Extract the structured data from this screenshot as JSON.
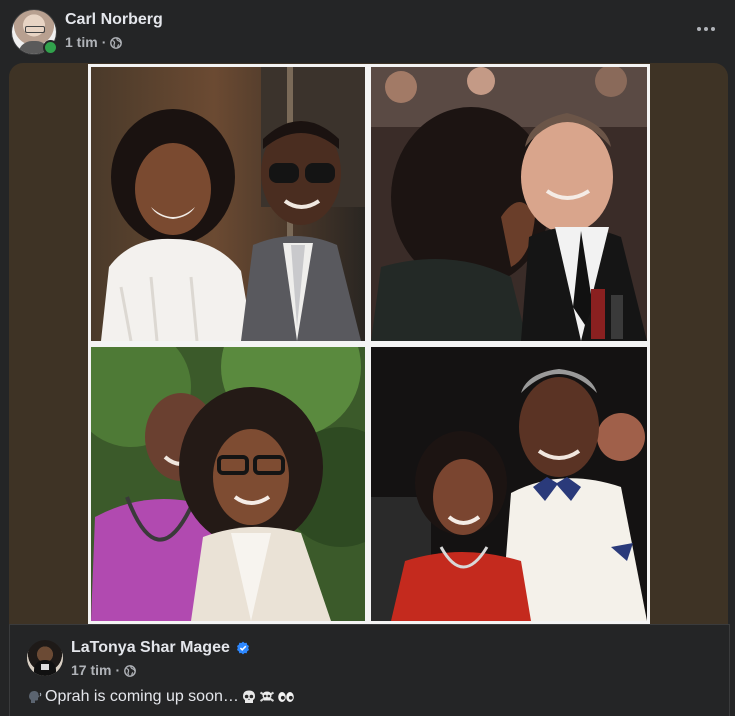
{
  "post": {
    "author": "Carl Norberg",
    "time": "1 tim",
    "separator": "·",
    "privacy_icon": "globe-icon",
    "more_icon": "more-options-icon",
    "online_color": "#31a24c"
  },
  "shared_post": {
    "author": "LaTonya Shar Magee",
    "verified_icon": "verified-badge-icon",
    "verified_color": "#2d88ff",
    "time": "17 tim",
    "separator": "·",
    "privacy_icon": "globe-icon",
    "text": "Oprah is coming up soon…",
    "leading_emoji": "speaking-head-icon",
    "trailing_emojis": [
      "skull-icon",
      "skull-crossbones-icon",
      "eyes-icon"
    ]
  },
  "colors": {
    "background": "#242526",
    "media_background": "#3e3325",
    "text_primary": "#e4e6eb",
    "text_secondary": "#b0b3b8"
  }
}
